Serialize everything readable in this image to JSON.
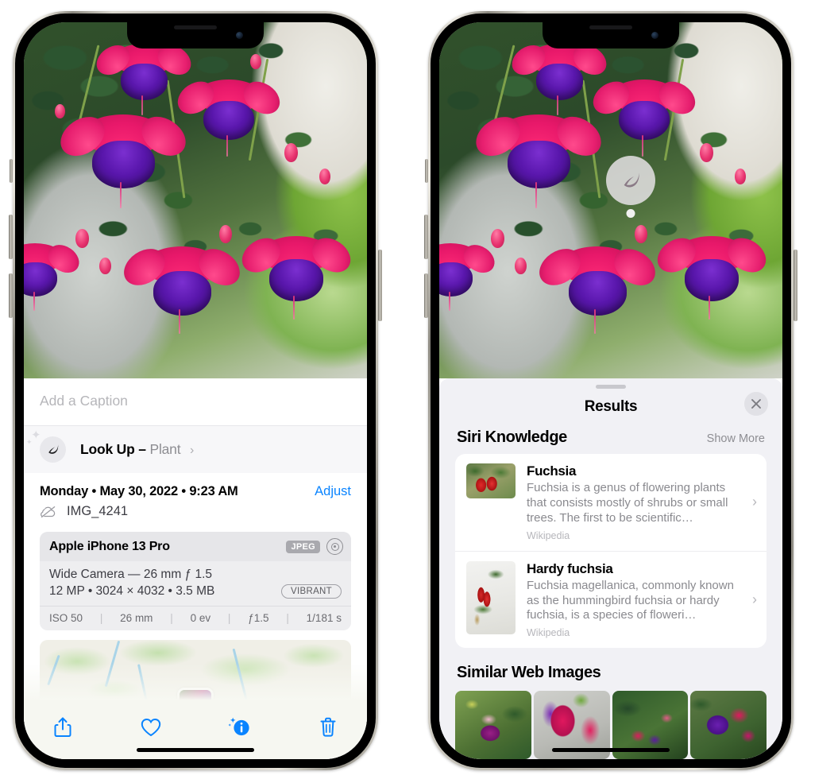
{
  "left_phone": {
    "caption_field": {
      "placeholder": "Add a Caption",
      "value": ""
    },
    "lookup_row": {
      "icon": "leaf-icon",
      "sparkle_icon": "sparkle-icon",
      "label": "Look Up –",
      "subject": "Plant",
      "chevron": "›"
    },
    "metadata": {
      "date": "Monday • May 30, 2022 • 9:23 AM",
      "adjust_label": "Adjust",
      "cloud_icon": "cloud-slash-icon",
      "filename": "IMG_4241"
    },
    "camera_card": {
      "device": "Apple iPhone 13 Pro",
      "format_badge": "JPEG",
      "raw_icon": "raw-circle-icon",
      "lens": "Wide Camera — 26 mm ƒ 1.5",
      "dimensions": "12 MP • 3024 × 4032 • 3.5 MB",
      "style_badge": "VIBRANT",
      "exif": [
        {
          "label": "ISO 50"
        },
        {
          "label": "26 mm"
        },
        {
          "label": "0 ev"
        },
        {
          "label": "ƒ1.5"
        },
        {
          "label": "1/181 s"
        }
      ],
      "exif_separator": "|"
    },
    "map": {
      "name": "location-map",
      "pin": "photo-pin"
    },
    "toolbar": [
      {
        "name": "share-button",
        "icon": "share-icon"
      },
      {
        "name": "favorite-button",
        "icon": "heart-icon"
      },
      {
        "name": "info-button",
        "icon": "info-sparkle-icon"
      },
      {
        "name": "delete-button",
        "icon": "trash-icon"
      }
    ]
  },
  "right_phone": {
    "lookup_badge": {
      "icon": "leaf-icon"
    },
    "results": {
      "title": "Results",
      "close_icon": "close-icon",
      "grabber": "sheet-grabber"
    },
    "siri_knowledge": {
      "title": "Siri Knowledge",
      "show_more": "Show More",
      "items": [
        {
          "title": "Fuchsia",
          "description": "Fuchsia is a genus of flowering plants that consists mostly of shrubs or small trees. The first to be scientific…",
          "source": "Wikipedia",
          "chevron": "›"
        },
        {
          "title": "Hardy fuchsia",
          "description": "Fuchsia magellanica, commonly known as the hummingbird fuchsia or hardy fuchsia, is a species of floweri…",
          "source": "Wikipedia",
          "chevron": "›"
        }
      ]
    },
    "similar_web_images": {
      "title": "Similar Web Images",
      "images": [
        {
          "name": "web-image-1"
        },
        {
          "name": "web-image-2"
        },
        {
          "name": "web-image-3"
        },
        {
          "name": "web-image-4"
        }
      ]
    }
  },
  "colors": {
    "accent_blue": "#0a84ff",
    "sheet_bg": "#f1f1f5",
    "card_bg": "#ffffff",
    "secondary_text": "#8e8e93"
  }
}
